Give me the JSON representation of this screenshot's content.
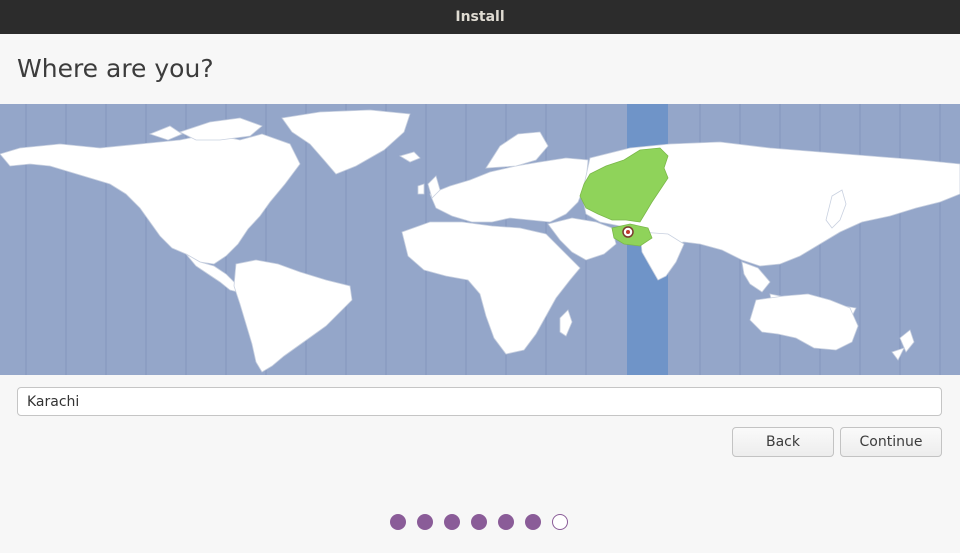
{
  "window": {
    "title": "Install"
  },
  "page": {
    "title": "Where are you?"
  },
  "map": {
    "ocean_color": "#94a6c9",
    "land_color": "#ffffff",
    "selected_zone_band_color": "#6f94c8",
    "selected_zone_land_color": "#8fd35a",
    "marker_icon": "location-pin-icon"
  },
  "location": {
    "value": "Karachi",
    "placeholder": ""
  },
  "buttons": {
    "back_label": "Back",
    "continue_label": "Continue"
  },
  "progress": {
    "total_steps": 7,
    "current_step": 7,
    "accent_color": "#8a5c98"
  }
}
